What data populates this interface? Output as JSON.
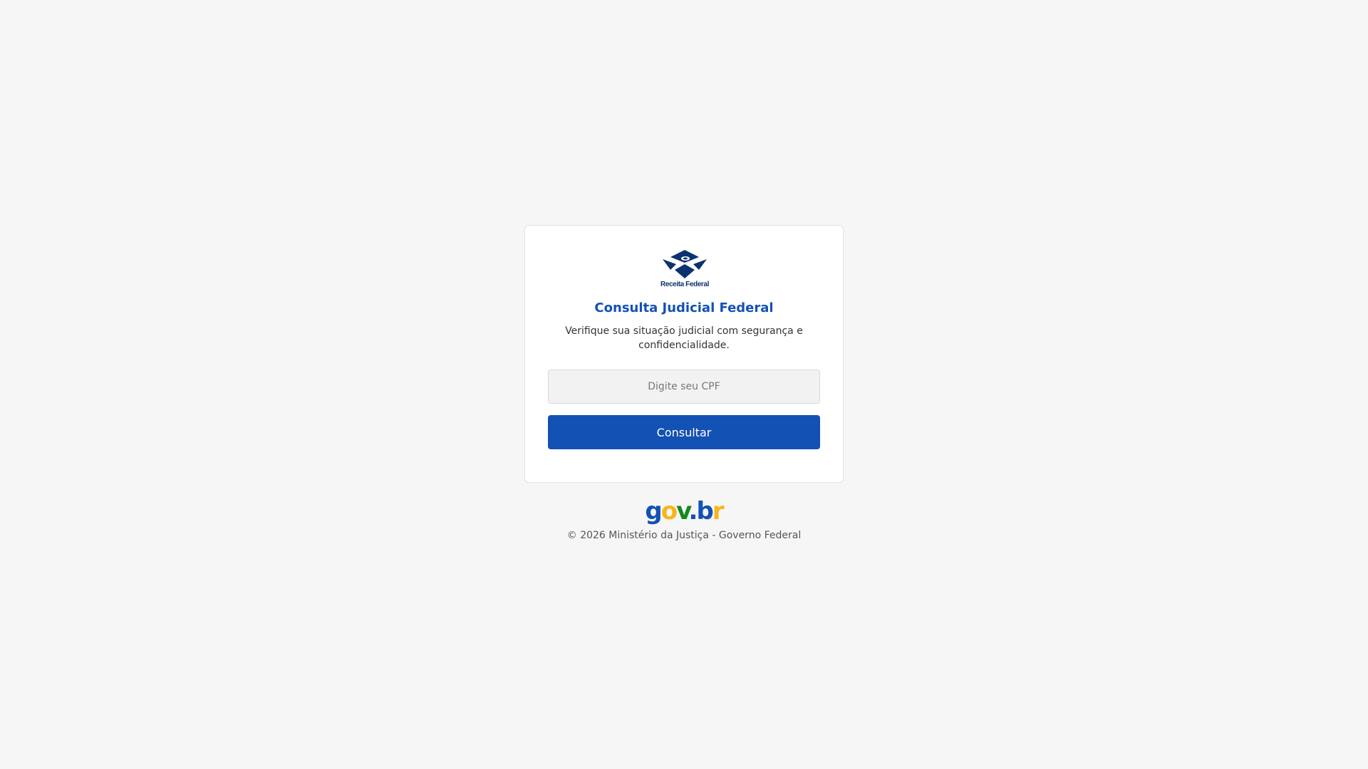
{
  "logo": {
    "icon": "receita-federal-logo-icon",
    "caption": "Receita Federal",
    "color": "#0c326f"
  },
  "card": {
    "title": "Consulta Judicial Federal",
    "subtitle": "Verifique sua situação judicial com segurança e confidencialidade.",
    "cpf_value": "",
    "cpf_placeholder": "Digite seu CPF",
    "submit_label": "Consultar"
  },
  "footer": {
    "brand": {
      "g": "g",
      "o": "o",
      "v": "v",
      "dot": ".",
      "b": "b",
      "r": "r"
    },
    "copyright": "© 2026 Ministério da Justiça - Governo Federal"
  },
  "colors": {
    "background": "#f6f6f6",
    "primary": "#1351b4",
    "gov_yellow": "#f8b51a",
    "gov_green": "#168821"
  }
}
